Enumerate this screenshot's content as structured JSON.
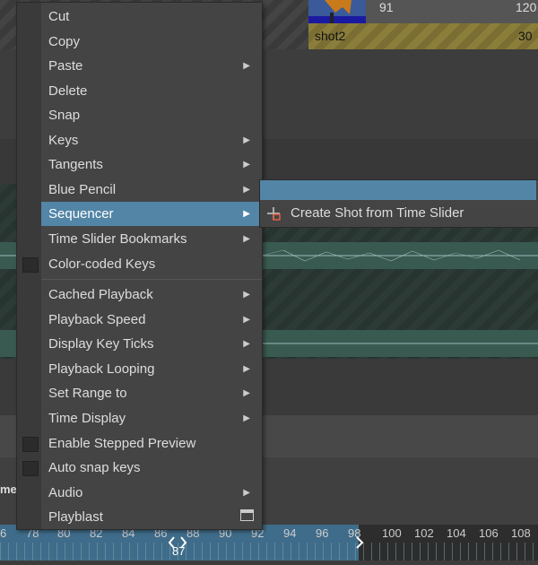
{
  "header": {
    "shot1_start": "91",
    "shot1_end": "120",
    "shot2_name": "shot2",
    "shot2_end": "30"
  },
  "side_text": "me",
  "context_menu": {
    "items": [
      {
        "label": "Cut",
        "submenu": false
      },
      {
        "label": "Copy",
        "submenu": false
      },
      {
        "label": "Paste",
        "submenu": true
      },
      {
        "label": "Delete",
        "submenu": false
      },
      {
        "label": "Snap",
        "submenu": false
      },
      {
        "label": "Keys",
        "submenu": true
      },
      {
        "label": "Tangents",
        "submenu": true
      },
      {
        "label": "Blue Pencil",
        "submenu": true
      },
      {
        "label": "Sequencer",
        "submenu": true,
        "active": true
      },
      {
        "label": "Time Slider Bookmarks",
        "submenu": true
      },
      {
        "label": "Color-coded Keys",
        "checkbox": true,
        "checked": false
      },
      {
        "label": "Cached Playback",
        "submenu": true
      },
      {
        "label": "Playback Speed",
        "submenu": true
      },
      {
        "label": "Display Key Ticks",
        "submenu": true
      },
      {
        "label": "Playback Looping",
        "submenu": true
      },
      {
        "label": "Set Range to",
        "submenu": true
      },
      {
        "label": "Time Display",
        "submenu": true
      },
      {
        "label": "Enable Stepped Preview",
        "checkbox": true,
        "checked": false
      },
      {
        "label": "Auto snap keys",
        "checkbox": true,
        "checked": false
      },
      {
        "label": "Audio",
        "submenu": true
      },
      {
        "label": "Playblast",
        "window_icon": true
      }
    ]
  },
  "submenu": {
    "item_label": "Create Shot from Time Slider",
    "icon": "create-shot-icon"
  },
  "timeline": {
    "ticks": [
      "6",
      "78",
      "80",
      "82",
      "84",
      "86",
      "88",
      "90",
      "92",
      "94",
      "96",
      "98",
      "100",
      "102",
      "104",
      "106",
      "108"
    ],
    "current_frame": "87",
    "colors": {
      "active_range": "#3f6c8a",
      "highlight": "#5285a6"
    }
  }
}
